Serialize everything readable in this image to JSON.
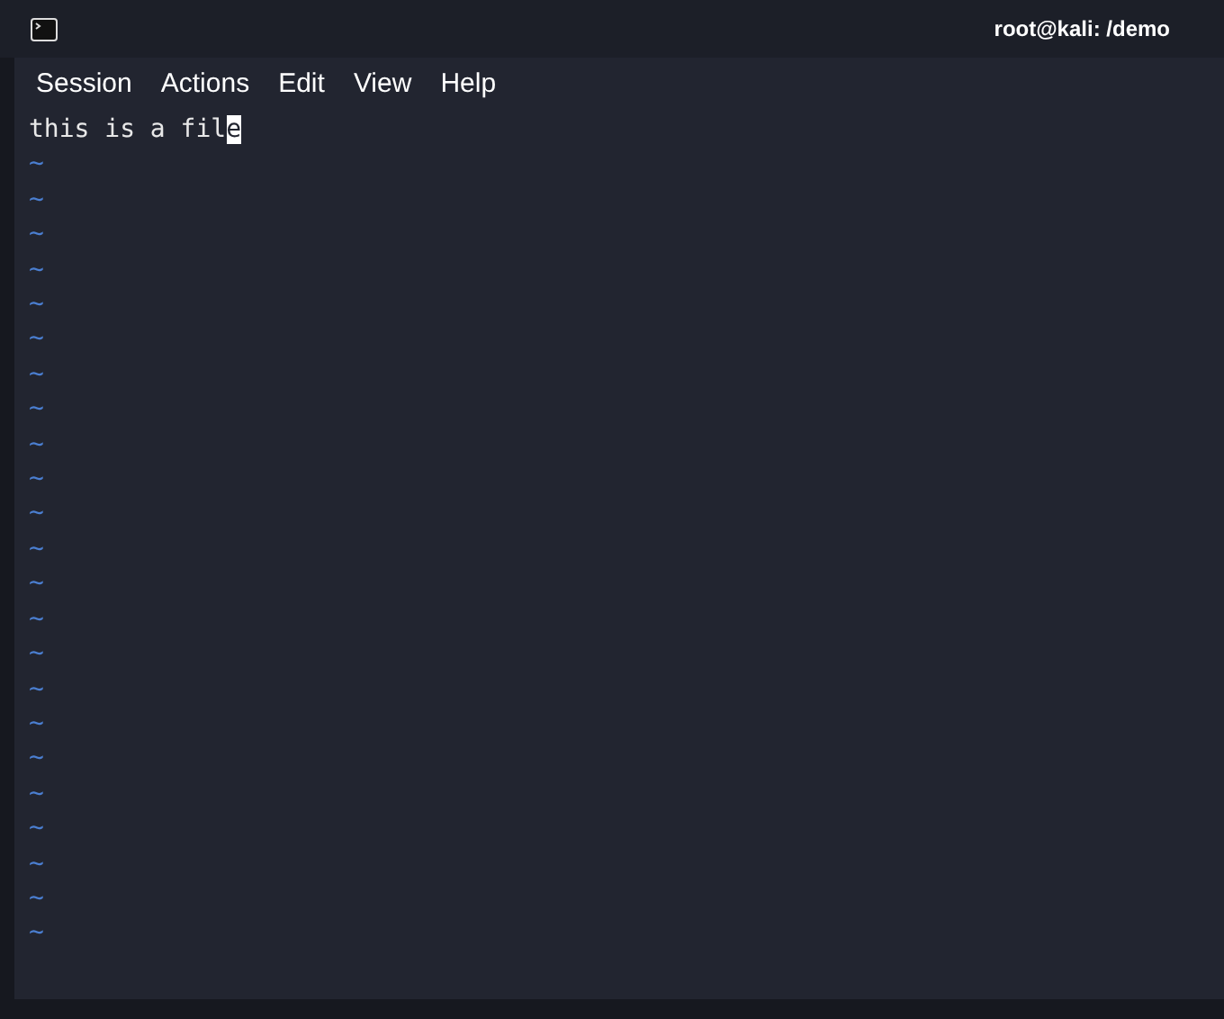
{
  "window": {
    "title": "root@kali: /demo"
  },
  "menu": [
    "Session",
    "Actions",
    "Edit",
    "View",
    "Help"
  ],
  "editor": {
    "line": {
      "before_cursor": "this is a fil",
      "at_cursor": "e"
    },
    "empty_lines": [
      "~",
      "~",
      "~",
      "~",
      "~",
      "~",
      "~",
      "~",
      "~",
      "~",
      "~",
      "~",
      "~",
      "~",
      "~",
      "~",
      "~",
      "~",
      "~",
      "~",
      "~",
      "~",
      "~"
    ]
  }
}
